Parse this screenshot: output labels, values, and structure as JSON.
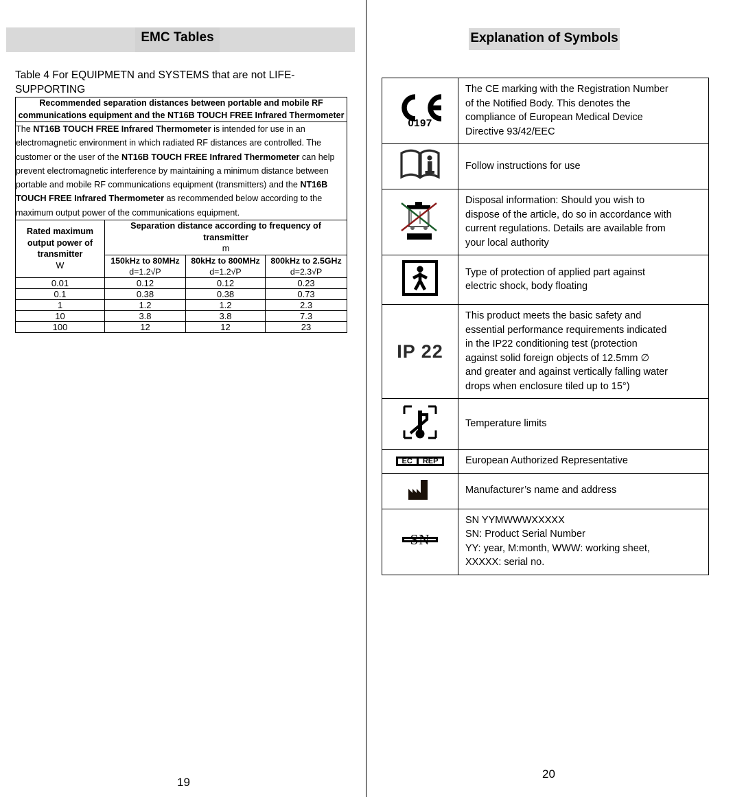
{
  "left_page": {
    "title": "EMC Tables",
    "caption": "Table 4 For EQUIPMETN and SYSTEMS that are not LIFE-SUPPORTING",
    "page_number": "19",
    "table": {
      "header": "Recommended separation distances between portable and mobile RF communications equipment and the NT16B TOUCH FREE Infrared Thermometer",
      "body_parts": [
        {
          "t": "The ",
          "b": false
        },
        {
          "t": "NT16B TOUCH FREE Infrared Thermometer",
          "b": true
        },
        {
          "t": " is intended for use in an electromagnetic environment in which radiated RF distances are controlled. The customer or the user of the ",
          "b": false
        },
        {
          "t": "NT16B TOUCH FREE Infrared Thermometer",
          "b": true
        },
        {
          "t": " can help prevent electromagnetic interference by maintaining a minimum distance between portable and mobile RF communications equipment (transmitters) and the ",
          "b": false
        },
        {
          "t": "NT16B TOUCH FREE Infrared Thermometer",
          "b": true
        },
        {
          "t": " as recommended below according to the maximum output power of the communications equipment.",
          "b": false
        }
      ],
      "col1_header": {
        "line1": "Rated maximum",
        "line2": "output power of",
        "line3": "transmitter",
        "unit": "W"
      },
      "span_header": {
        "line1": "Separation distance according to frequency of",
        "line2": "transmitter",
        "unit": "m"
      },
      "freq_headers": [
        {
          "range": "150kHz to 80MHz",
          "formula": "d=1.2√P"
        },
        {
          "range": "80kHz to 800MHz",
          "formula": "d=1.2√P"
        },
        {
          "range": "800kHz to 2.5GHz",
          "formula": "d=2.3√P"
        }
      ],
      "rows": [
        {
          "power": "0.01",
          "c1": "0.12",
          "c2": "0.12",
          "c3": "0.23"
        },
        {
          "power": "0.1",
          "c1": "0.38",
          "c2": "0.38",
          "c3": "0.73"
        },
        {
          "power": "1",
          "c1": "1.2",
          "c2": "1.2",
          "c3": "2.3"
        },
        {
          "power": "10",
          "c1": "3.8",
          "c2": "3.8",
          "c3": "7.3"
        },
        {
          "power": "100",
          "c1": "12",
          "c2": "12",
          "c3": "23"
        }
      ]
    }
  },
  "right_page": {
    "title": "Explanation of Symbols",
    "page_number": "20",
    "symbols": [
      {
        "icon": "ce-marking-icon",
        "icon_text": "0197",
        "lines": [
          "The CE marking with the Registration Number",
          "of the Notified Body. This denotes the",
          "compliance of European Medical Device",
          "Directive 93/42/EEC"
        ]
      },
      {
        "icon": "instructions-manual-icon",
        "icon_text": "",
        "lines": [
          "Follow instructions for use"
        ]
      },
      {
        "icon": "weee-crossed-bin-icon",
        "icon_text": "",
        "lines": [
          "Disposal information: Should you wish to",
          "dispose of the article, do so in accordance with",
          "current regulations. Details are available from",
          "your local authority"
        ]
      },
      {
        "icon": "body-floating-bf-icon",
        "icon_text": "",
        "lines": [
          "Type of protection of applied part against",
          "electric shock, body floating"
        ]
      },
      {
        "icon": "ip22-rating-icon",
        "icon_text": "IP 22",
        "lines": [
          "This product meets the basic safety and",
          "essential performance requirements indicated",
          "in the IP22 conditioning test (protection",
          "against solid foreign objects of 12.5mm  ∅",
          "and greater and against vertically falling water",
          "drops when enclosure tiled up to 15°)"
        ]
      },
      {
        "icon": "temperature-limits-icon",
        "icon_text": "",
        "lines": [
          "Temperature limits"
        ]
      },
      {
        "icon": "ec-rep-icon",
        "icon_text": "EC | REP",
        "lines": [
          "European Authorized Representative"
        ]
      },
      {
        "icon": "manufacturer-factory-icon",
        "icon_text": "",
        "lines": [
          "Manufacturer’s name and address"
        ]
      },
      {
        "icon": "serial-number-icon",
        "icon_text": "SN",
        "lines": [
          "SN YYMWWWXXXXX",
          "SN: Product Serial Number",
          "YY: year, M:month, WWW: working sheet,",
          "XXXXX: serial no."
        ]
      }
    ],
    "ec_rep_labels": {
      "ec": "EC",
      "rep": "REP"
    }
  },
  "colors": {
    "header_band": "#d9d9d9",
    "title_highlight": "#d2d2d2",
    "border": "#000000"
  }
}
